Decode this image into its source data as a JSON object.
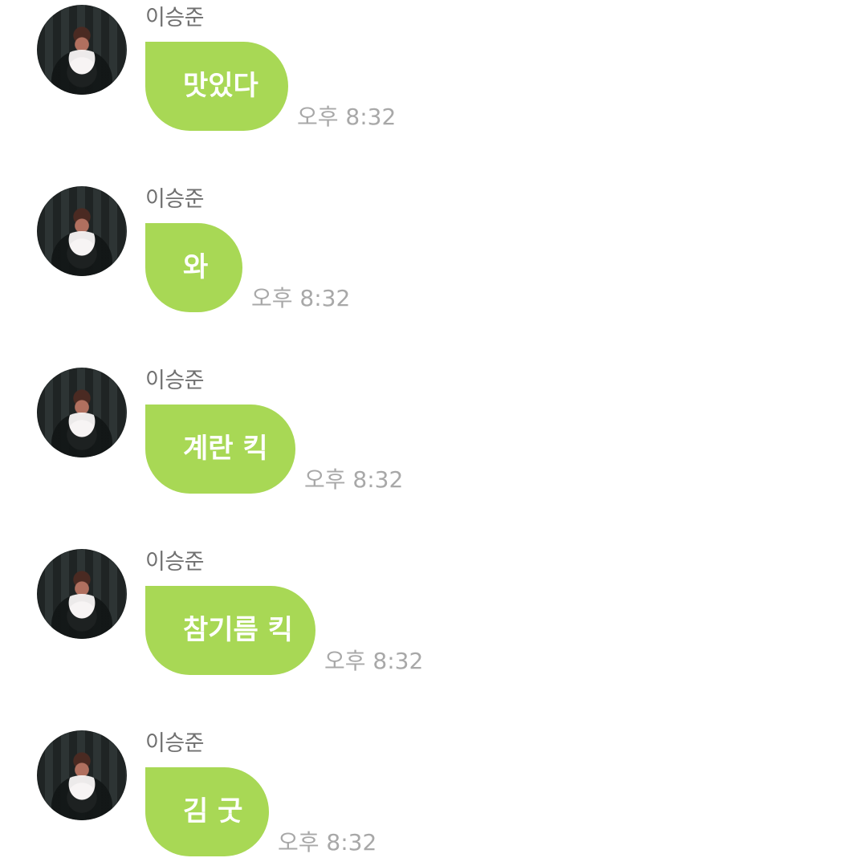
{
  "messages": [
    {
      "sender": "이승준",
      "text": "맛있다",
      "time": "오후 8:32"
    },
    {
      "sender": "이승준",
      "text": "와",
      "time": "오후 8:32"
    },
    {
      "sender": "이승준",
      "text": "계란 킥",
      "time": "오후 8:32"
    },
    {
      "sender": "이승준",
      "text": "참기름 킥",
      "time": "오후 8:32"
    },
    {
      "sender": "이승준",
      "text": "김 굿",
      "time": "오후 8:32"
    }
  ],
  "colors": {
    "bubble": "#a8d855",
    "bubble_text": "#ffffff",
    "sender": "#707070",
    "time": "#a8a8a8"
  },
  "icons": {
    "avatar": "avatar"
  }
}
